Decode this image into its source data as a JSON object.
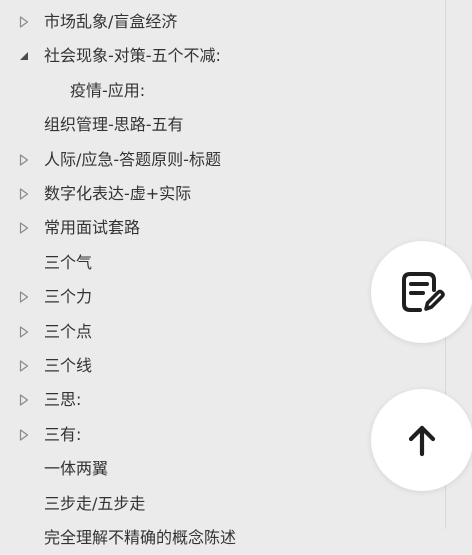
{
  "outline": {
    "items": [
      {
        "label": "市场乱象/盲盒经济",
        "toggle": "collapsed",
        "indent": 0
      },
      {
        "label": "社会现象-对策-五个不减:",
        "toggle": "expanded",
        "indent": 0
      },
      {
        "label": "疫情-应用:",
        "toggle": "none",
        "indent": 1
      },
      {
        "label": "组织管理-思路-五有",
        "toggle": "none",
        "indent": 0
      },
      {
        "label": "人际/应急-答题原则-标题",
        "toggle": "collapsed",
        "indent": 0
      },
      {
        "label": "数字化表达-虚+实际",
        "toggle": "collapsed",
        "indent": 0
      },
      {
        "label": "常用面试套路",
        "toggle": "collapsed",
        "indent": 0
      },
      {
        "label": "三个气",
        "toggle": "none",
        "indent": 0
      },
      {
        "label": "三个力",
        "toggle": "collapsed",
        "indent": 0
      },
      {
        "label": "三个点",
        "toggle": "collapsed",
        "indent": 0
      },
      {
        "label": "三个线",
        "toggle": "collapsed",
        "indent": 0
      },
      {
        "label": "三思:",
        "toggle": "collapsed",
        "indent": 0
      },
      {
        "label": "三有:",
        "toggle": "collapsed",
        "indent": 0
      },
      {
        "label": "一体两翼",
        "toggle": "none",
        "indent": 0
      },
      {
        "label": "三步走/五步走",
        "toggle": "none",
        "indent": 0
      },
      {
        "label": "完全理解不精确的概念陈述",
        "toggle": "none",
        "indent": 0
      }
    ]
  },
  "fabs": {
    "edit_icon": "edit-note-icon",
    "top_icon": "arrow-up-icon"
  },
  "colors": {
    "background": "#ebebeb",
    "text": "#333333",
    "toggle": "#8a8a8a",
    "fab_bg": "#ffffff",
    "icon": "#1f1f1f"
  }
}
